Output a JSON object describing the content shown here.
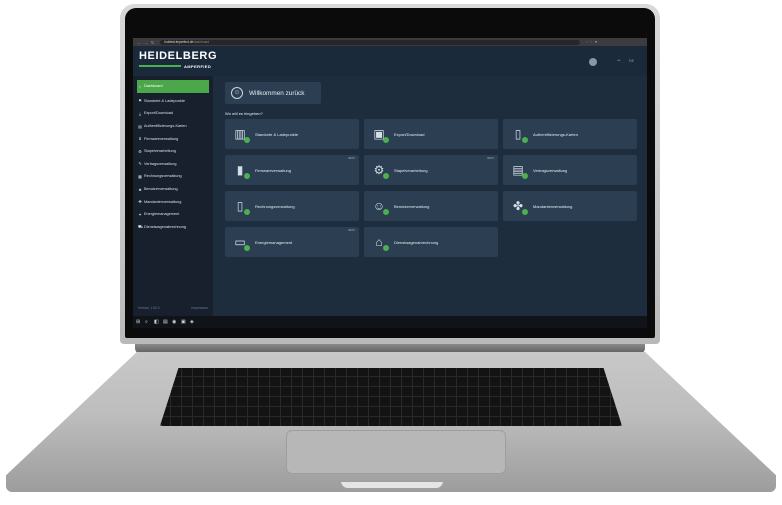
{
  "browser": {
    "domain": "hubtest.imperfect.de",
    "path": "/dashboard",
    "nav_icons": [
      "←",
      "→",
      "↻"
    ]
  },
  "brand": {
    "logo": "HEIDELBERG",
    "sub": "AMPERFIED",
    "accent": "#4caf50",
    "background": "#1d2d3e"
  },
  "topbar": {
    "minus": "−",
    "lang": "DE"
  },
  "sidebar": {
    "items": [
      {
        "label": "Dashboard",
        "icon": "▪"
      },
      {
        "label": "Standorte & Ladepunkte",
        "icon": "⚑"
      },
      {
        "label": "Export/Download",
        "icon": "⤓"
      },
      {
        "label": "Authentifizierungs-Karten",
        "icon": "▤"
      },
      {
        "label": "Firmwareverwaltung",
        "icon": "⬇"
      },
      {
        "label": "Stapelverarbeitung",
        "icon": "⚙"
      },
      {
        "label": "Vertragsverwaltung",
        "icon": "✎"
      },
      {
        "label": "Rechnungsverwaltung",
        "icon": "▦"
      },
      {
        "label": "Benutzerverwaltung",
        "icon": "♣"
      },
      {
        "label": "Mandantenverwaltung",
        "icon": "✤"
      },
      {
        "label": "Energiemanagement",
        "icon": "✦"
      },
      {
        "label": "Dienstwagenabrechnung",
        "icon": "⛟"
      }
    ],
    "footer_left": "Version 1.60.0",
    "footer_right": "Impressum"
  },
  "welcome": {
    "title": "Willkommen zurück",
    "question": "Wo will es hingehen?"
  },
  "tiles": [
    {
      "label": "Standorte & Ladepunkte",
      "icon": "▥",
      "tag": ""
    },
    {
      "label": "Export/Download",
      "icon": "▣",
      "tag": ""
    },
    {
      "label": "Authentifizierungs-Karten",
      "icon": "▯",
      "tag": ""
    },
    {
      "label": "Firmwareverwaltung",
      "icon": "▮",
      "tag": "BETA"
    },
    {
      "label": "Stapelverarbeitung",
      "icon": "⚙",
      "tag": "BETA"
    },
    {
      "label": "Vertragsverwaltung",
      "icon": "▤",
      "tag": ""
    },
    {
      "label": "Rechnungsverwaltung",
      "icon": "▯",
      "tag": ""
    },
    {
      "label": "Benutzerverwaltung",
      "icon": "☺",
      "tag": ""
    },
    {
      "label": "Mandantenverwaltung",
      "icon": "✤",
      "tag": ""
    },
    {
      "label": "Energiemanagement",
      "icon": "▭",
      "tag": "BETA"
    },
    {
      "label": "Dienstwagenabrechnung",
      "icon": "⌂",
      "tag": ""
    }
  ],
  "taskbar": {
    "icons": [
      "⊞",
      "⌕",
      "◧",
      "▤",
      "◉",
      "▣",
      "◈"
    ]
  }
}
